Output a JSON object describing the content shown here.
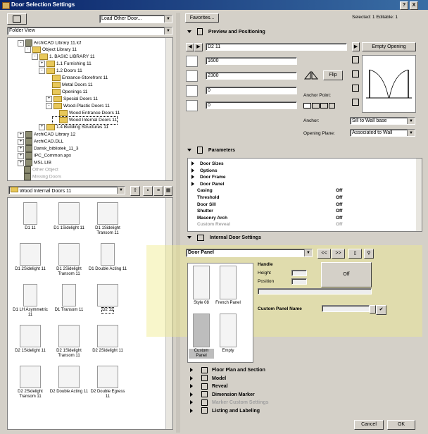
{
  "window": {
    "title": "Door Selection Settings",
    "help": "?",
    "close": "X"
  },
  "left": {
    "load_other": "Load Other Door...",
    "view_mode": "Folder View",
    "tree": [
      {
        "label": "ArchiCAD Library 11.lcf",
        "lvl": 1,
        "exp": "-",
        "kind": "lib"
      },
      {
        "label": "Object Library 11",
        "lvl": 2,
        "exp": "-",
        "kind": "fold"
      },
      {
        "label": "1. BASIC LIBRARY 11",
        "lvl": 3,
        "exp": "-",
        "kind": "fold"
      },
      {
        "label": "1.1 Furnishing 11",
        "lvl": 4,
        "exp": "+",
        "kind": "fold"
      },
      {
        "label": "1.2 Doors 11",
        "lvl": 4,
        "exp": "-",
        "kind": "fold"
      },
      {
        "label": "Entrance-Storefront 11",
        "lvl": 5,
        "exp": "",
        "kind": "fold"
      },
      {
        "label": "Metal Doors 11",
        "lvl": 5,
        "exp": "",
        "kind": "fold"
      },
      {
        "label": "Openings 11",
        "lvl": 5,
        "exp": "",
        "kind": "fold"
      },
      {
        "label": "Special Doors 11",
        "lvl": 5,
        "exp": "+",
        "kind": "fold"
      },
      {
        "label": "Wood-Plastic Doors 11",
        "lvl": 5,
        "exp": "-",
        "kind": "fold"
      },
      {
        "label": "Wood Entrance Doors 11",
        "lvl": 6,
        "exp": "",
        "kind": "fold"
      },
      {
        "label": "Wood Internal Doors 11",
        "lvl": 6,
        "exp": "",
        "kind": "fold",
        "selected": true
      },
      {
        "label": "1.4 Building Structures 11",
        "lvl": 4,
        "exp": "+",
        "kind": "fold"
      },
      {
        "label": "ArchiCAD Library 12",
        "lvl": 1,
        "exp": "+",
        "kind": "lib"
      },
      {
        "label": "ArchiCAD.DLL",
        "lvl": 1,
        "exp": "+",
        "kind": "lib"
      },
      {
        "label": "Dansk_bibliotek_11_3",
        "lvl": 1,
        "exp": "+",
        "kind": "lib"
      },
      {
        "label": "IPC_Common.apx",
        "lvl": 1,
        "exp": "+",
        "kind": "lib"
      },
      {
        "label": "MSL.LIB",
        "lvl": 1,
        "exp": "+",
        "kind": "lib"
      },
      {
        "label": "Other Object",
        "lvl": 1,
        "exp": "",
        "kind": "lib",
        "grey": true
      },
      {
        "label": "Missing Doors",
        "lvl": 1,
        "exp": "",
        "kind": "lib",
        "grey": true
      }
    ],
    "folder_select": "Wood Internal Doors 11",
    "thumbs": [
      {
        "label": "D1 11"
      },
      {
        "label": "D1 1Sidelight 11"
      },
      {
        "label": "D1 1Sidelight Transom 11"
      },
      {
        "label": "D1 2Sidelight 11"
      },
      {
        "label": "D1 2Sidelight Transom 11"
      },
      {
        "label": "D1 Double Acting 11"
      },
      {
        "label": "D1 LH Asymmetric 11"
      },
      {
        "label": "D1 Transom 11"
      },
      {
        "label": "D2 11",
        "selected": true
      },
      {
        "label": "D2 1Sidelight 11"
      },
      {
        "label": "D2 1Sidelight Transom 11"
      },
      {
        "label": "D2 2Sidelight 11"
      },
      {
        "label": "D2 2Sidelight Transom 11"
      },
      {
        "label": "D2 Double Acting 11"
      },
      {
        "label": "D2 Double Egress 11"
      }
    ]
  },
  "right": {
    "favorites": "Favorites...",
    "selection_info": "Selected: 1 Editable: 1",
    "preview_title": "Preview and Positioning",
    "door_name": "D2 11",
    "empty_opening": "Empty Opening",
    "width": "1600",
    "height": "2300",
    "field3": "0",
    "field4": "0",
    "flip": "Flip",
    "anchor_point": "Anchor Point:",
    "anchor_label": "Anchor:",
    "anchor_value": "Sill to Wall base",
    "opening_plane_label": "Opening Plane:",
    "opening_plane_value": "Associated to Wall",
    "parameters_title": "Parameters",
    "params": [
      {
        "name": "Door Sizes",
        "value": "",
        "group": true
      },
      {
        "name": "Options",
        "value": "",
        "group": true
      },
      {
        "name": "Door Frame",
        "value": "",
        "group": true
      },
      {
        "name": "Door Panel",
        "value": "",
        "group": true
      },
      {
        "name": "Casing",
        "value": "Off"
      },
      {
        "name": "Threshold",
        "value": "Off"
      },
      {
        "name": "Door Sill",
        "value": "Off"
      },
      {
        "name": "Shutter",
        "value": "Off"
      },
      {
        "name": "Masonry Arch",
        "value": "Off"
      },
      {
        "name": "Custom Reveal",
        "value": "Off",
        "grey": true
      }
    ],
    "internal_title": "Internal Door Settings",
    "door_panel_select": "Door Panel",
    "prev": "<<",
    "next": ">>",
    "panel_styles": [
      {
        "label": "Style 08"
      },
      {
        "label": "French Panel"
      },
      {
        "label": "Custom Panel",
        "selected": true
      },
      {
        "label": "Empty"
      }
    ],
    "handle_label": "Handle",
    "height_label": "Height",
    "position_label": "Position",
    "handle_value": "Off",
    "custom_panel_name": "Custom Panel Name",
    "bottom_sections": [
      {
        "label": "Floor Plan and Section"
      },
      {
        "label": "Model"
      },
      {
        "label": "Reveal"
      },
      {
        "label": "Dimension Marker"
      },
      {
        "label": "Marker Custom Settings",
        "grey": true
      },
      {
        "label": "Listing and Labeling"
      }
    ],
    "cancel": "Cancel",
    "ok": "OK"
  }
}
